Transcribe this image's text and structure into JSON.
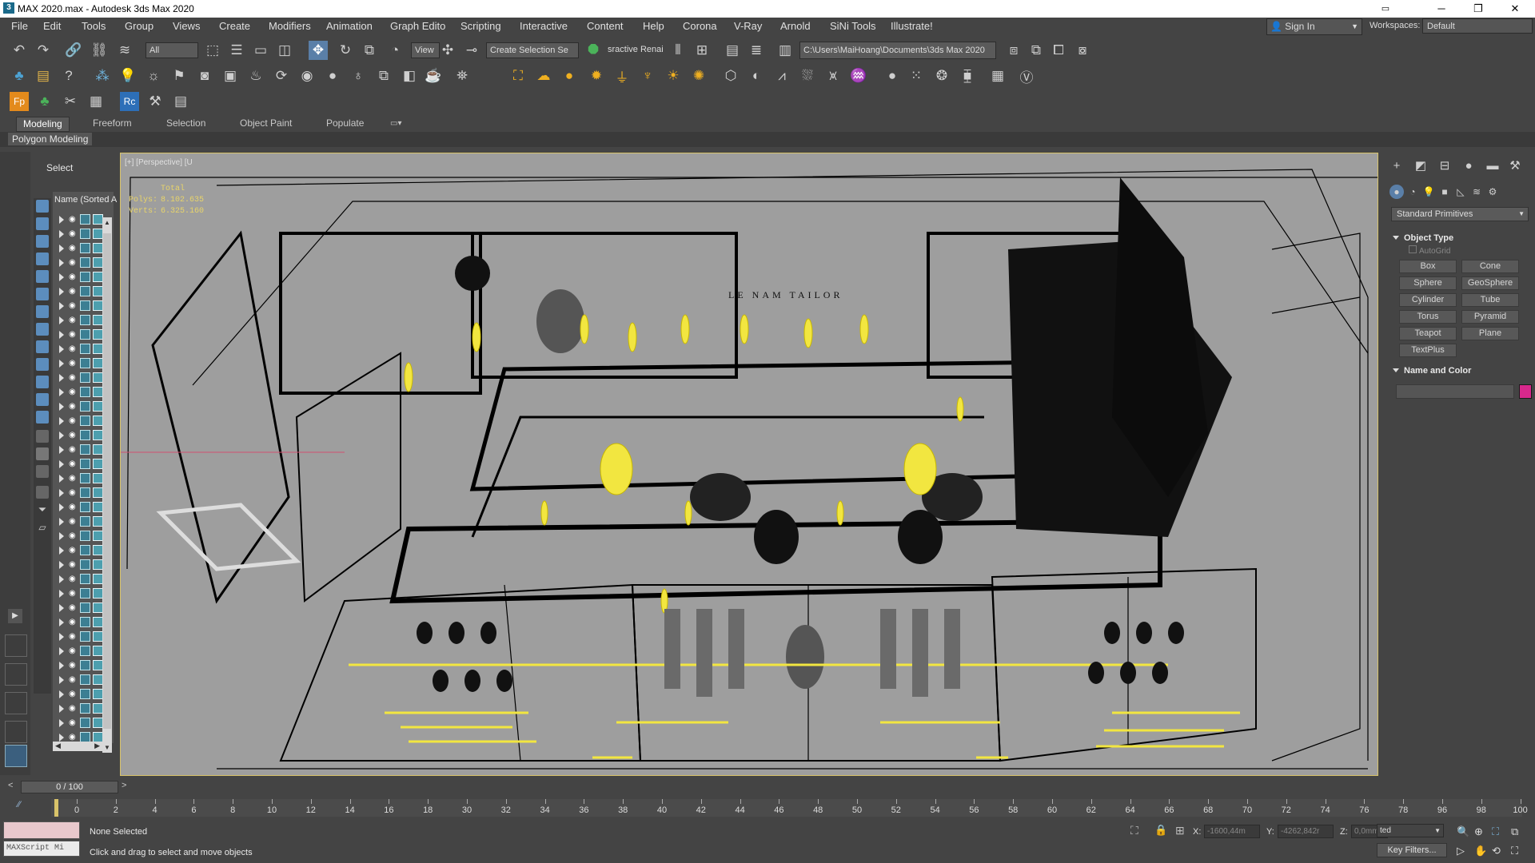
{
  "titlebar": {
    "title": "MAX 2020.max - Autodesk 3ds Max 2020",
    "app_icon": "3ds-max-icon",
    "min": "─",
    "max": "❐",
    "close": "✕"
  },
  "menubar": {
    "items": [
      "File",
      "Edit",
      "Tools",
      "Group",
      "Views",
      "Create",
      "Modifiers",
      "Animation",
      "Graph Edito",
      "Scripting",
      "Interactive",
      "Content",
      "Help",
      "Corona",
      "V-Ray",
      "Arnold",
      "SiNi Tools",
      "Illustrate!"
    ],
    "sign_in": "Sign In",
    "workspaces_label": "Workspaces:",
    "workspace_value": "Default"
  },
  "toolbar": {
    "filter_value": "All",
    "view_value": "View",
    "selection_set_placeholder": "Create Selection Se",
    "render_label": "sractive Renai",
    "project_path": "C:\\Users\\MaiHoang\\Documents\\3ds Max 2020"
  },
  "ribbon": {
    "tabs": [
      "Modeling",
      "Freeform",
      "Selection",
      "Object Paint",
      "Populate"
    ],
    "active_tab": "Modeling",
    "sub_label": "Polygon Modeling"
  },
  "explorer": {
    "select_label": "Select",
    "column_header": "Name (Sorted A"
  },
  "viewport": {
    "label": "[+] [Perspective] [U",
    "stats_title": "Total",
    "polys_label": "Polys:",
    "polys_value": "8.102.635",
    "verts_label": "Verts:",
    "verts_value": "6.325.160",
    "sign_text": "LE NAM TAILOR"
  },
  "command_panel": {
    "dropdown": "Standard Primitives",
    "object_type_title": "Object Type",
    "autogrid": "AutoGrid",
    "primitives": [
      "Box",
      "Cone",
      "Sphere",
      "GeoSphere",
      "Cylinder",
      "Tube",
      "Torus",
      "Pyramid",
      "Teapot",
      "Plane",
      "TextPlus"
    ],
    "name_color_title": "Name and Color",
    "swatch_color": "#d8288c"
  },
  "timeslider": {
    "frame_display": "0 / 100"
  },
  "track": {
    "labels": [
      "0",
      "2",
      "4",
      "6",
      "8",
      "10",
      "12",
      "14",
      "16",
      "18",
      "30",
      "32",
      "34",
      "36",
      "38",
      "40",
      "42",
      "44",
      "46",
      "48",
      "50",
      "52",
      "54",
      "56",
      "58",
      "60",
      "62",
      "64",
      "66",
      "68",
      "70",
      "72",
      "74",
      "76",
      "78",
      "96",
      "98",
      "100"
    ]
  },
  "status": {
    "selection": "None Selected",
    "prompt": "Click and drag to select and move objects",
    "maxscript": "MAXScript Mi",
    "x_label": "X:",
    "x_value": "-1600,44m",
    "y_label": "Y:",
    "y_value": "-4262,842r",
    "z_label": "Z:",
    "z_value": "0,0mm",
    "selected_dropdown": "ted",
    "key_filters": "Key Filters..."
  }
}
